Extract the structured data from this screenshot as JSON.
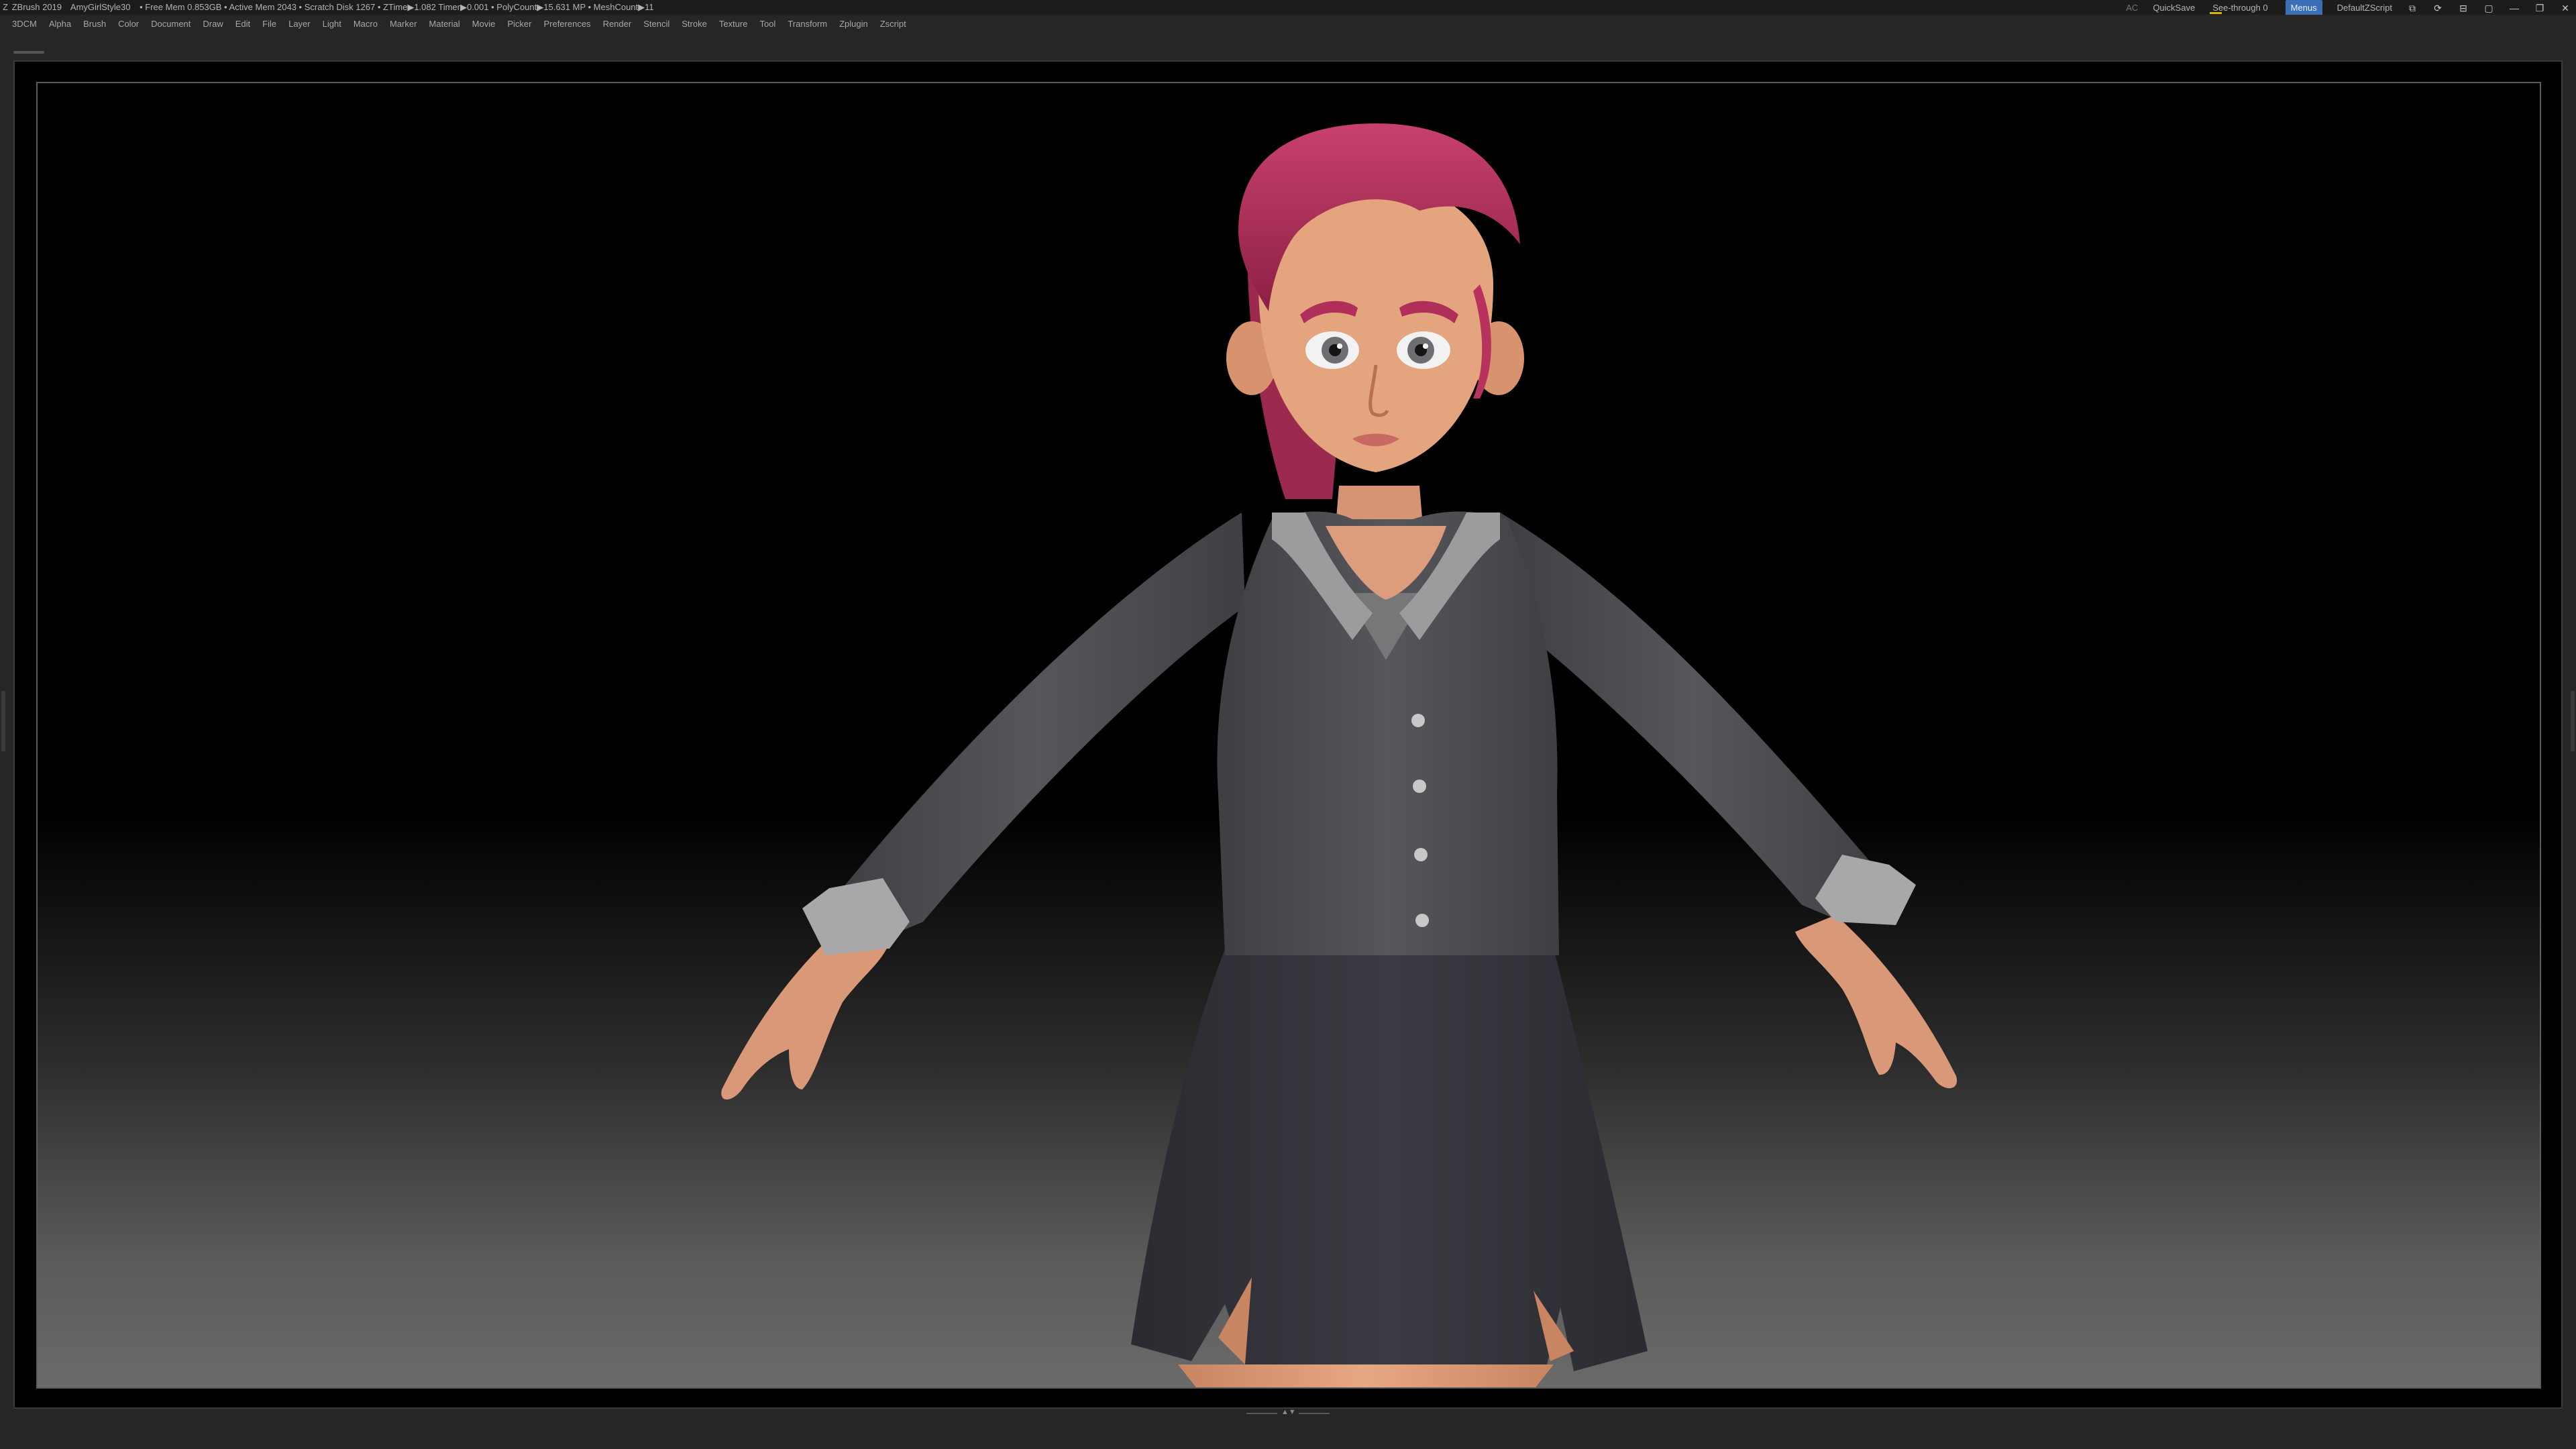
{
  "titlebar": {
    "app_icon": "zbrush-logo-icon",
    "app_name": "ZBrush 2019",
    "document_name": "AmyGirlStyle30",
    "status": "• Free Mem 0.853GB • Active Mem 2043 • Scratch Disk 1267 • ZTime▶1.082 Timer▶0.001 • PolyCount▶15.631 MP • MeshCount▶11",
    "ac_label": "AC",
    "quicksave_label": "QuickSave",
    "see_through_label": "See-through 0",
    "menus_label": "Menus",
    "script_label": "DefaultZScript",
    "window_icons": [
      "layout-icon",
      "refresh-icon",
      "dock-icon",
      "lock-icon",
      "minimize-icon",
      "restore-icon",
      "close-icon"
    ],
    "window_glyphs": [
      "⧉",
      "⟳",
      "⊟",
      "▢",
      "—",
      "❐",
      "✕"
    ]
  },
  "menubar": {
    "items": [
      "3DCM",
      "Alpha",
      "Brush",
      "Color",
      "Document",
      "Draw",
      "Edit",
      "File",
      "Layer",
      "Light",
      "Macro",
      "Marker",
      "Material",
      "Movie",
      "Picker",
      "Preferences",
      "Render",
      "Stencil",
      "Stroke",
      "Texture",
      "Tool",
      "Transform",
      "Zplugin",
      "Zscript"
    ]
  },
  "canvas": {
    "subject": "3d-character-model",
    "colors": {
      "hair": "#b8325e",
      "skin": "#e0a07a",
      "jacket": "#4e4e52",
      "skirt": "#33343b",
      "collar": "#9c9c9c",
      "background_top": "#000000",
      "background_bottom": "#6a6a6a"
    }
  }
}
